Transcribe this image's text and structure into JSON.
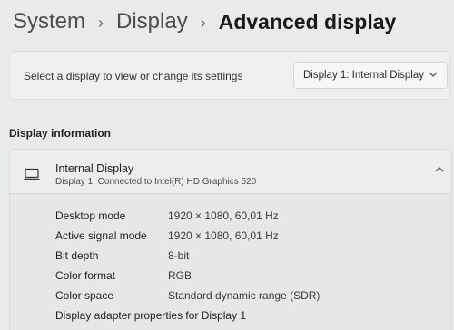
{
  "breadcrumb": {
    "items": [
      "System",
      "Display",
      "Advanced display"
    ]
  },
  "selector": {
    "label": "Select a display to view or change its settings",
    "value": "Display 1: Internal Display"
  },
  "section": {
    "title": "Display information"
  },
  "display": {
    "name": "Internal Display",
    "subtitle": "Display 1: Connected to Intel(R) HD Graphics 520",
    "rows": [
      {
        "label": "Desktop mode",
        "value": "1920 × 1080, 60,01 Hz"
      },
      {
        "label": "Active signal mode",
        "value": "1920 × 1080, 60,01 Hz"
      },
      {
        "label": "Bit depth",
        "value": "8-bit"
      },
      {
        "label": "Color format",
        "value": "RGB"
      },
      {
        "label": "Color space",
        "value": "Standard dynamic range (SDR)"
      }
    ],
    "adapter_link": "Display adapter properties for Display 1"
  },
  "icons": {
    "breadcrumb_separator": "chevron-right-icon",
    "dropdown": "chevron-down-icon",
    "display": "monitor-icon",
    "collapse": "chevron-up-icon"
  }
}
